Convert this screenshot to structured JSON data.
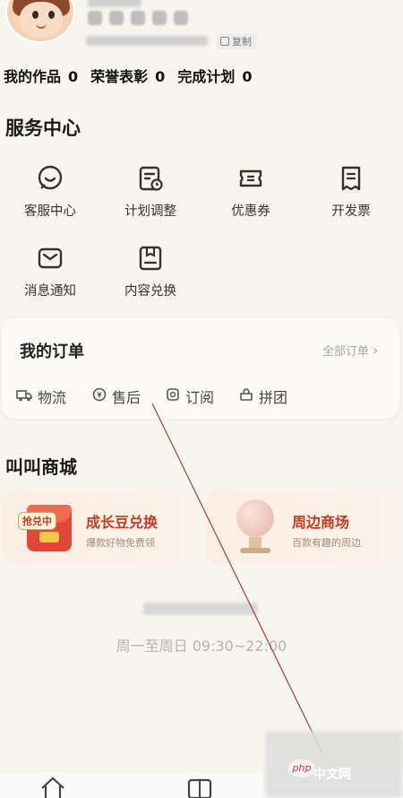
{
  "profile": {
    "copy_label": "复制"
  },
  "stats": [
    {
      "label": "我的作品",
      "value": "0"
    },
    {
      "label": "荣誉表彰",
      "value": "0"
    },
    {
      "label": "完成计划",
      "value": "0"
    }
  ],
  "service": {
    "title": "服务中心",
    "items": [
      {
        "label": "客服中心",
        "icon": "chat-bubble-icon"
      },
      {
        "label": "计划调整",
        "icon": "plan-adjust-icon"
      },
      {
        "label": "优惠券",
        "icon": "coupon-icon"
      },
      {
        "label": "开发票",
        "icon": "invoice-icon"
      },
      {
        "label": "消息通知",
        "icon": "envelope-icon"
      },
      {
        "label": "内容兑换",
        "icon": "redeem-icon"
      }
    ]
  },
  "orders": {
    "title": "我的订单",
    "all_label": "全部订单",
    "items": [
      {
        "label": "物流",
        "icon": "truck-icon"
      },
      {
        "label": "售后",
        "icon": "after-sale-icon"
      },
      {
        "label": "订阅",
        "icon": "subscribe-icon"
      },
      {
        "label": "拼团",
        "icon": "group-buy-icon"
      }
    ]
  },
  "mall": {
    "title": "叫叫商城",
    "cards": [
      {
        "name": "成长豆兑换",
        "sub": "爆款好物免费领",
        "tag": "抢兑中"
      },
      {
        "name": "周边商场",
        "sub": "百款有趣的周边"
      }
    ]
  },
  "service_hours": "周一至周日 09:30~22:00",
  "watermark": {
    "brand": "php",
    "text": "中文网"
  },
  "colors": {
    "background": "#f7f5ee",
    "accent": "#c23a1f",
    "muted": "#b3b3b3"
  }
}
